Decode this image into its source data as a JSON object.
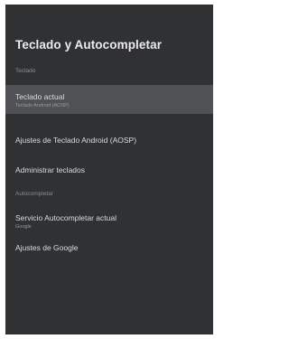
{
  "screen": {
    "title": "Teclado y Autocompletar"
  },
  "sections": [
    {
      "header": "Teclado",
      "items": [
        {
          "label": "Teclado actual",
          "subtitle": "Teclado Android (AOSP)",
          "selected": true
        },
        {
          "label": "Ajustes de Teclado Android (AOSP)"
        },
        {
          "label": "Administrar teclados"
        }
      ]
    },
    {
      "header": "Autocompletar",
      "items": [
        {
          "label": "Servicio Autocompletar actual",
          "subtitle": "Google"
        },
        {
          "label": "Ajustes de Google"
        }
      ]
    }
  ],
  "colors": {
    "panel_background": "#303133",
    "selected_background": "#505155",
    "title_text": "#ececec",
    "header_text": "#8c8d90"
  }
}
